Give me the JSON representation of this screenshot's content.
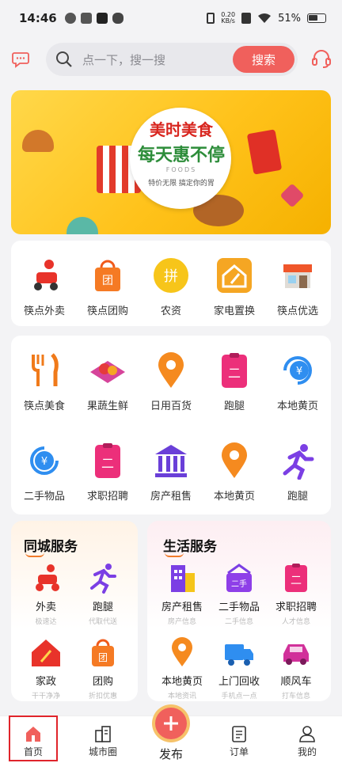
{
  "status_bar": {
    "time": "14:46",
    "speed_top": "0.20",
    "speed_bottom": "KB/s",
    "battery": "51%"
  },
  "search": {
    "placeholder": "点一下，搜一搜",
    "button": "搜索"
  },
  "banner": {
    "title_line1": "美时美食",
    "title_line2": "每天惠不停",
    "foods": "FOODS",
    "slogan": "特价无限 搞定你的胃"
  },
  "quick_links": [
    {
      "label": "筷点外卖",
      "icon": "delivery-scooter-icon"
    },
    {
      "label": "筷点团购",
      "icon": "group-bag-icon"
    },
    {
      "label": "农资",
      "icon": "pin-coin-icon"
    },
    {
      "label": "家电置换",
      "icon": "home-broom-icon"
    },
    {
      "label": "筷点优选",
      "icon": "storefront-icon"
    }
  ],
  "categories": [
    {
      "label": "筷点美食",
      "icon": "fork-knife-icon"
    },
    {
      "label": "果蔬生鲜",
      "icon": "fruit-basket-icon"
    },
    {
      "label": "日用百货",
      "icon": "location-pin-icon"
    },
    {
      "label": "跑腿",
      "icon": "errand-clipboard-icon"
    },
    {
      "label": "本地黄页",
      "icon": "yuan-refresh-icon"
    },
    {
      "label": "二手物品",
      "icon": "yuan-circle-icon"
    },
    {
      "label": "求职招聘",
      "icon": "job-clipboard-icon"
    },
    {
      "label": "房产租售",
      "icon": "bank-building-icon"
    },
    {
      "label": "本地黄页",
      "icon": "location-pin-icon"
    },
    {
      "label": "跑腿",
      "icon": "running-man-icon"
    }
  ],
  "city_services": {
    "title": "同城服务",
    "items": [
      {
        "name": "外卖",
        "sub": "极速达",
        "icon": "delivery-scooter-icon"
      },
      {
        "name": "跑腿",
        "sub": "代取代送",
        "icon": "running-man-icon"
      },
      {
        "name": "家政",
        "sub": "干干净净",
        "icon": "house-cleaning-icon"
      },
      {
        "name": "团购",
        "sub": "折扣优惠",
        "icon": "group-bag-icon"
      }
    ]
  },
  "life_services": {
    "title": "生活服务",
    "items": [
      {
        "name": "房产租售",
        "sub": "房产信息",
        "icon": "building-icon"
      },
      {
        "name": "二手物品",
        "sub": "二手信息",
        "icon": "secondhand-basket-icon"
      },
      {
        "name": "求职招聘",
        "sub": "人才信息",
        "icon": "job-clipboard-icon"
      },
      {
        "name": "本地黄页",
        "sub": "本地资讯",
        "icon": "location-pin-icon"
      },
      {
        "name": "上门回收",
        "sub": "手机点一点",
        "icon": "recycle-truck-icon"
      },
      {
        "name": "顺风车",
        "sub": "打车信息",
        "icon": "car-icon"
      }
    ]
  },
  "bottom_nav": {
    "items": [
      {
        "label": "首页",
        "icon": "home-icon",
        "active": true
      },
      {
        "label": "城市圈",
        "icon": "city-icon",
        "active": false
      },
      {
        "label": "订单",
        "icon": "order-icon",
        "active": false
      },
      {
        "label": "我的",
        "icon": "profile-icon",
        "active": false
      }
    ],
    "publish_label": "发布"
  },
  "colors": {
    "accent": "#f0605c",
    "active_frame": "#e0242b",
    "banner_yellow": "#ffc21a"
  }
}
